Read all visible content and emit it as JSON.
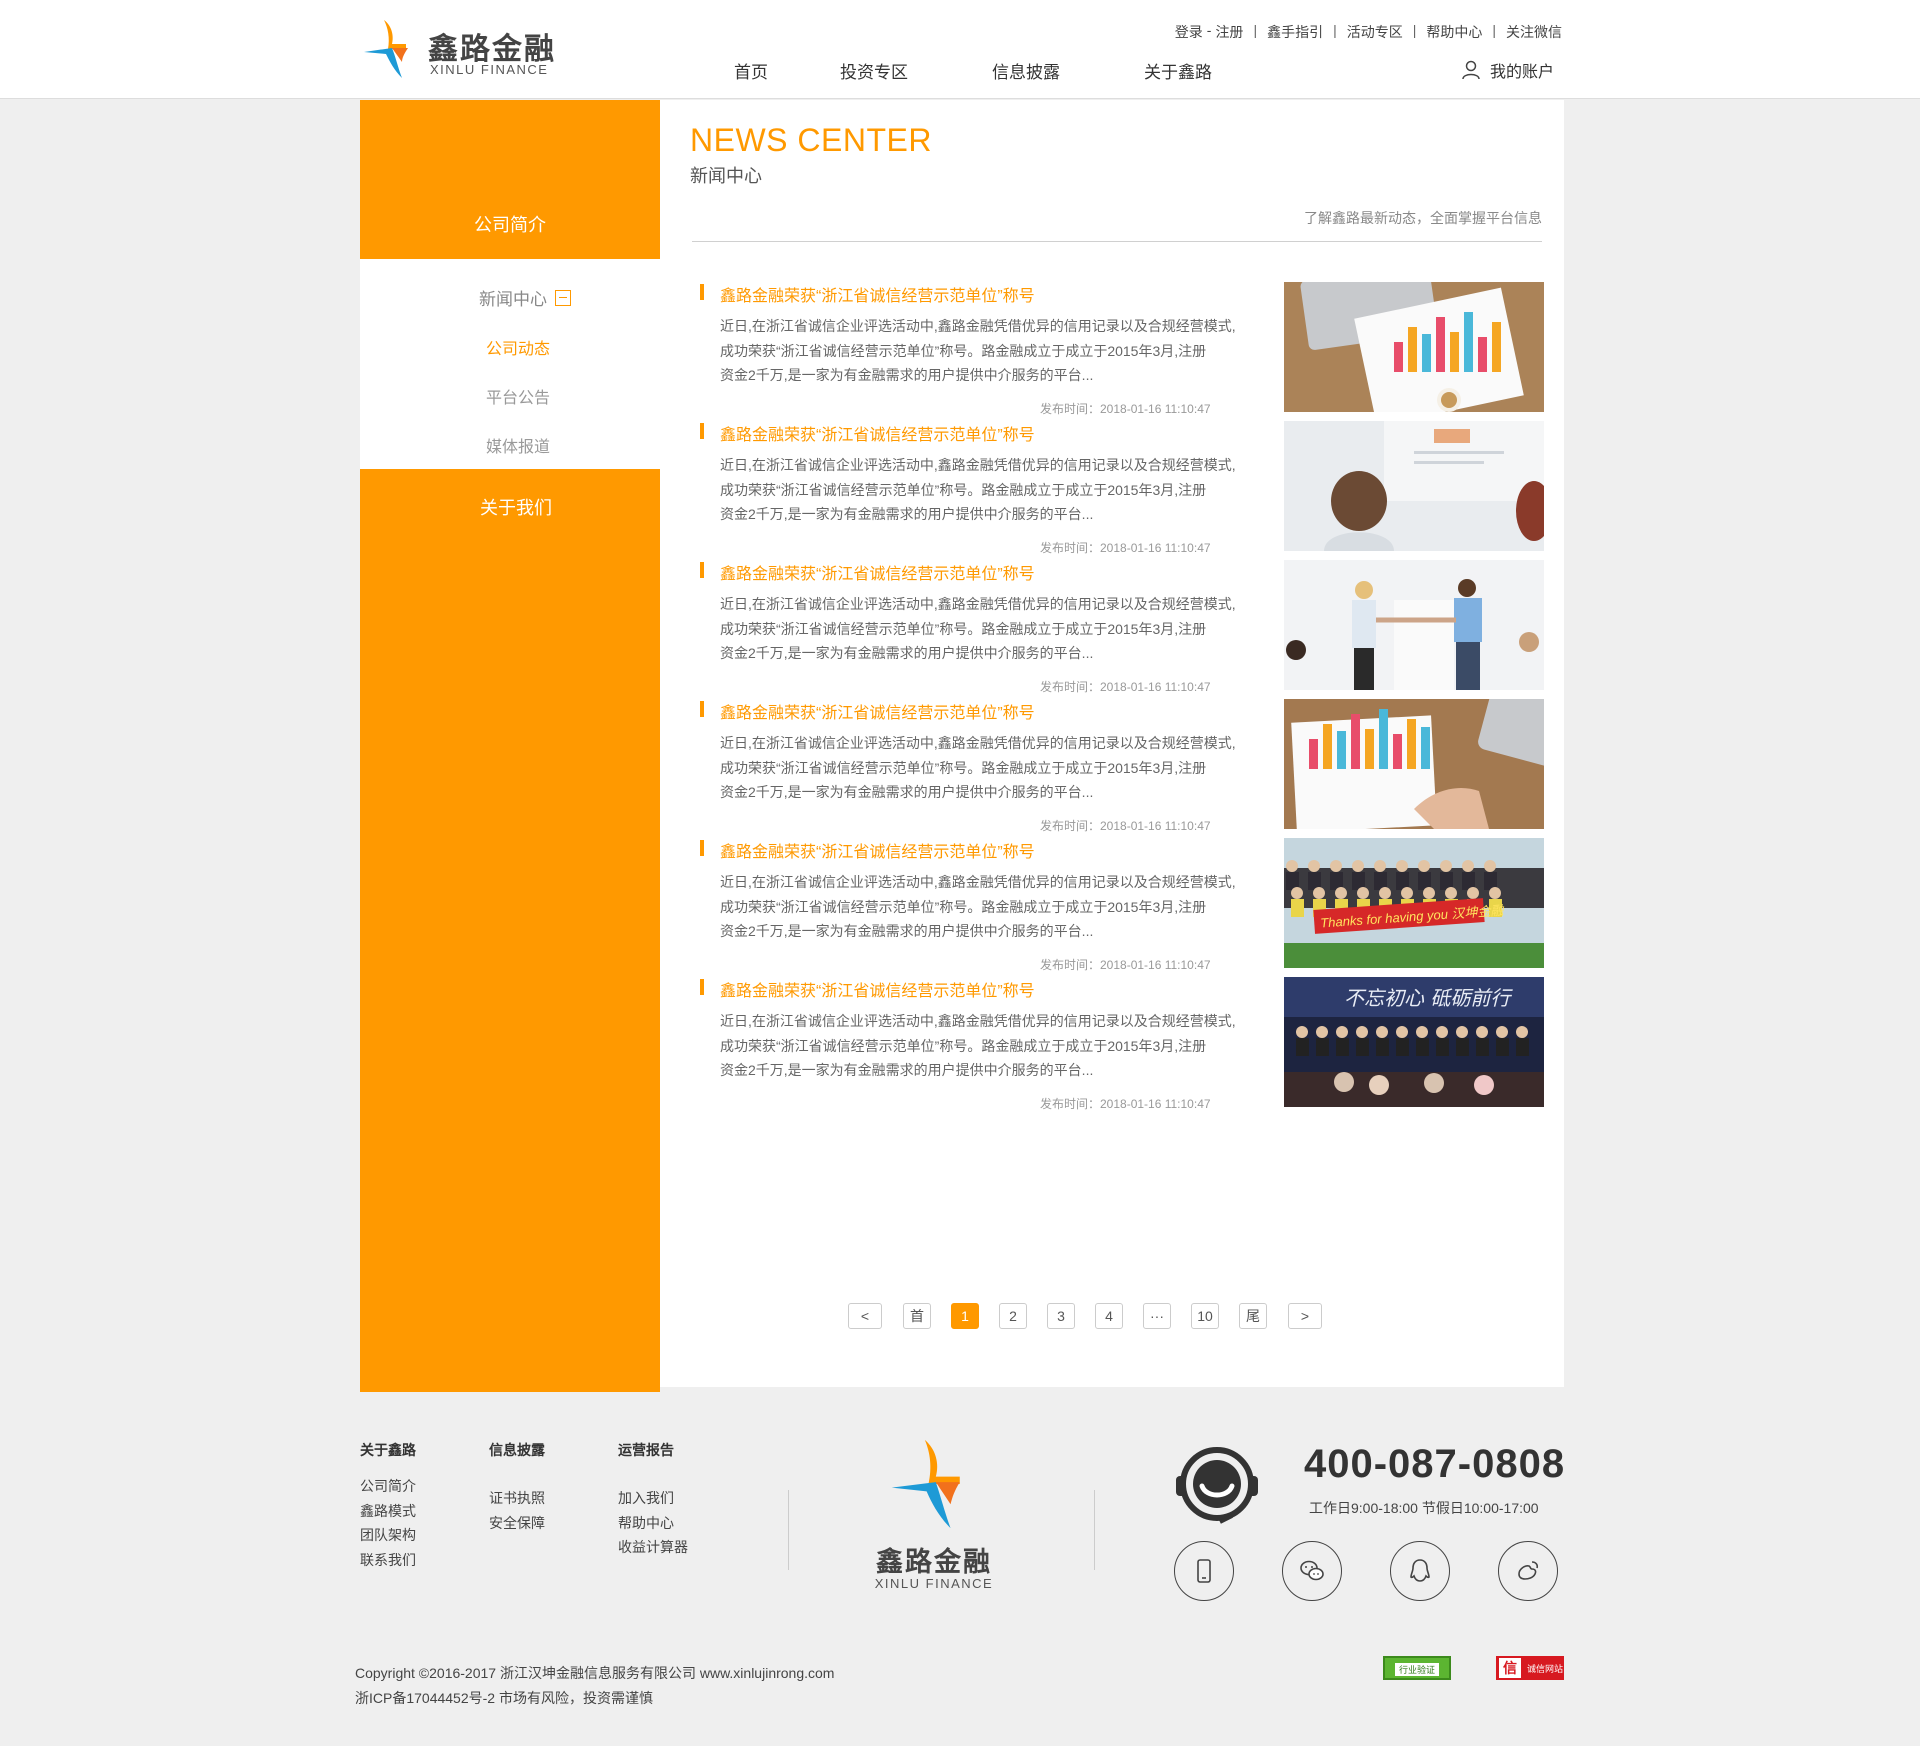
{
  "header": {
    "logo_cn": "鑫路金融",
    "logo_en": "XINLU FINANCE",
    "toplinks": [
      "登录",
      "注册",
      "鑫手指引",
      "活动专区",
      "帮助中心",
      "关注微信"
    ],
    "login_sep": "-",
    "nav": [
      "首页",
      "投资专区",
      "信息披露",
      "关于鑫路"
    ],
    "account": "我的账户"
  },
  "sidebar": {
    "top": "公司简介",
    "section": "新闻中心",
    "subs": [
      "公司动态",
      "平台公告",
      "媒体报道"
    ],
    "active": "公司动态",
    "about": "关于我们"
  },
  "news": {
    "title": "NEWS CENTER",
    "subtitle": "新闻中心",
    "desc": "了解鑫路最新动态，全面掌握平台信息",
    "articles": [
      {
        "title": "鑫路金融荣获“浙江省诚信经营示范单位”称号",
        "line1": "近日,在浙江省诚信企业评选活动中,鑫路金融凭借优异的信用记录以及合规经营模式,",
        "line2": "成功荣获“浙江省诚信经营示范单位”称号。路金融成立于成立于2015年3月,注册",
        "line3": "资金2千万,是一家为有金融需求的用户提供中介服务的平台...",
        "time": "发布时间：2018-01-16 11:10:47",
        "image": "chart-on-desk"
      },
      {
        "title": "鑫路金融荣获“浙江省诚信经营示范单位”称号",
        "line1": "近日,在浙江省诚信企业评选活动中,鑫路金融凭借优异的信用记录以及合规经营模式,",
        "line2": "成功荣获“浙江省诚信经营示范单位”称号。路金融成立于成立于2015年3月,注册",
        "line3": "资金2千万,是一家为有金融需求的用户提供中介服务的平台...",
        "time": "发布时间：2018-01-16 11:10:47",
        "image": "meeting-whiteboard"
      },
      {
        "title": "鑫路金融荣获“浙江省诚信经营示范单位”称号",
        "line1": "近日,在浙江省诚信企业评选活动中,鑫路金融凭借优异的信用记录以及合规经营模式,",
        "line2": "成功荣获“浙江省诚信经营示范单位”称号。路金融成立于成立于2015年3月,注册",
        "line3": "资金2千万,是一家为有金融需求的用户提供中介服务的平台...",
        "time": "发布时间：2018-01-16 11:10:47",
        "image": "handshake"
      },
      {
        "title": "鑫路金融荣获“浙江省诚信经营示范单位”称号",
        "line1": "近日,在浙江省诚信企业评选活动中,鑫路金融凭借优异的信用记录以及合规经营模式,",
        "line2": "成功荣获“浙江省诚信经营示范单位”称号。路金融成立于成立于2015年3月,注册",
        "line3": "资金2千万,是一家为有金融需求的用户提供中介服务的平台...",
        "time": "发布时间：2018-01-16 11:10:47",
        "image": "chart-hand"
      },
      {
        "title": "鑫路金融荣获“浙江省诚信经营示范单位”称号",
        "line1": "近日,在浙江省诚信企业评选活动中,鑫路金融凭借优异的信用记录以及合规经营模式,",
        "line2": "成功荣获“浙江省诚信经营示范单位”称号。路金融成立于成立于2015年3月,注册",
        "line3": "资金2千万,是一家为有金融需求的用户提供中介服务的平台...",
        "time": "发布时间：2018-01-16 11:10:47",
        "image": "group-banner",
        "banner_text": "Thanks for having you 汉坤金融"
      },
      {
        "title": "鑫路金融荣获“浙江省诚信经营示范单位”称号",
        "line1": "近日,在浙江省诚信企业评选活动中,鑫路金融凭借优异的信用记录以及合规经营模式,",
        "line2": "成功荣获“浙江省诚信经营示范单位”称号。路金融成立于成立于2015年3月,注册",
        "line3": "资金2千万,是一家为有金融需求的用户提供中介服务的平台...",
        "time": "发布时间：2018-01-16 11:10:47",
        "image": "stage-event",
        "banner_text": "不忘初心 砥砺前行"
      }
    ]
  },
  "pager": [
    "<",
    "首",
    "1",
    "2",
    "3",
    "4",
    "···",
    "10",
    "尾",
    ">"
  ],
  "pager_active": "1",
  "footer": {
    "col1": {
      "head": "关于鑫路",
      "links": [
        "公司简介",
        "鑫路模式",
        "团队架构",
        "联系我们"
      ]
    },
    "col2": {
      "head": "信息披露",
      "links": [
        "证书执照",
        "安全保障"
      ]
    },
    "col3": {
      "head": "运营报告",
      "links": [
        "加入我们",
        "帮助中心",
        "收益计算器"
      ]
    },
    "logo_cn": "鑫路金融",
    "logo_en": "XINLU FINANCE",
    "phone": "400-087-0808",
    "hours": "工作日9:00-18:00  节假日10:00-17:00",
    "social": [
      "mobile-icon",
      "wechat-icon",
      "qq-icon",
      "weibo-icon"
    ],
    "copyright": "Copyright ©2016-2017 浙江汉坤金融信息服务有限公司 www.xinlujinrong.com",
    "icp": "浙ICP备17044452号-2 市场有风险，投资需谨慎",
    "badge1": "行业验证",
    "badge2_mark": "信",
    "badge2": "诚信网站"
  },
  "colors": {
    "accent": "#ff9900",
    "blue": "#1e9ad6"
  }
}
